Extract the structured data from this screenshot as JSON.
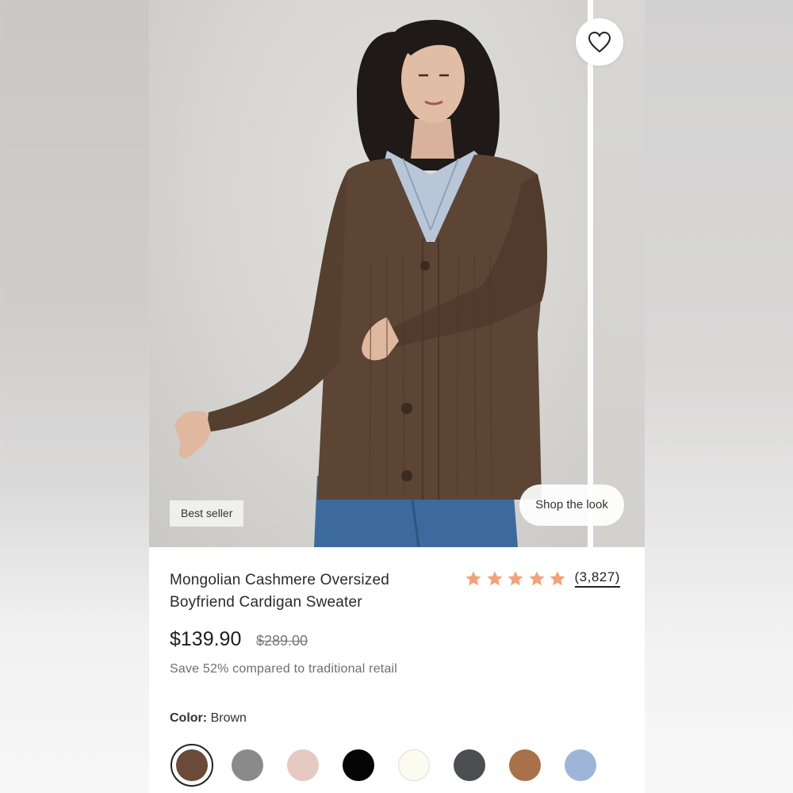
{
  "product": {
    "badge": "Best seller",
    "shop_the_look": "Shop the look",
    "title": "Mongolian Cashmere Oversized Boyfriend Cardigan Sweater",
    "rating": {
      "stars": 5,
      "count_label": "(3,827)"
    },
    "price": "$139.90",
    "original_price": "$289.00",
    "savings_text": "Save 52% compared to traditional retail",
    "color": {
      "label": "Color:",
      "value": "Brown"
    }
  },
  "swatches": [
    {
      "name": "brown",
      "hex": "#6b4a3a",
      "selected": true
    },
    {
      "name": "gray",
      "hex": "#8a8a8a",
      "selected": false
    },
    {
      "name": "blush",
      "hex": "#e6c9c1",
      "selected": false
    },
    {
      "name": "black",
      "hex": "#050505",
      "selected": false
    },
    {
      "name": "ivory",
      "hex": "#fbfbef",
      "selected": false
    },
    {
      "name": "charcoal",
      "hex": "#4d4e52",
      "selected": false
    },
    {
      "name": "camel",
      "hex": "#a8714a",
      "selected": false
    },
    {
      "name": "light-blue",
      "hex": "#9db6d8",
      "selected": false
    }
  ],
  "colors": {
    "star": "#f2a27a",
    "background": "#ffffff"
  },
  "icons": {
    "favorite": "heart-outline-icon",
    "rating": "star-icon"
  }
}
